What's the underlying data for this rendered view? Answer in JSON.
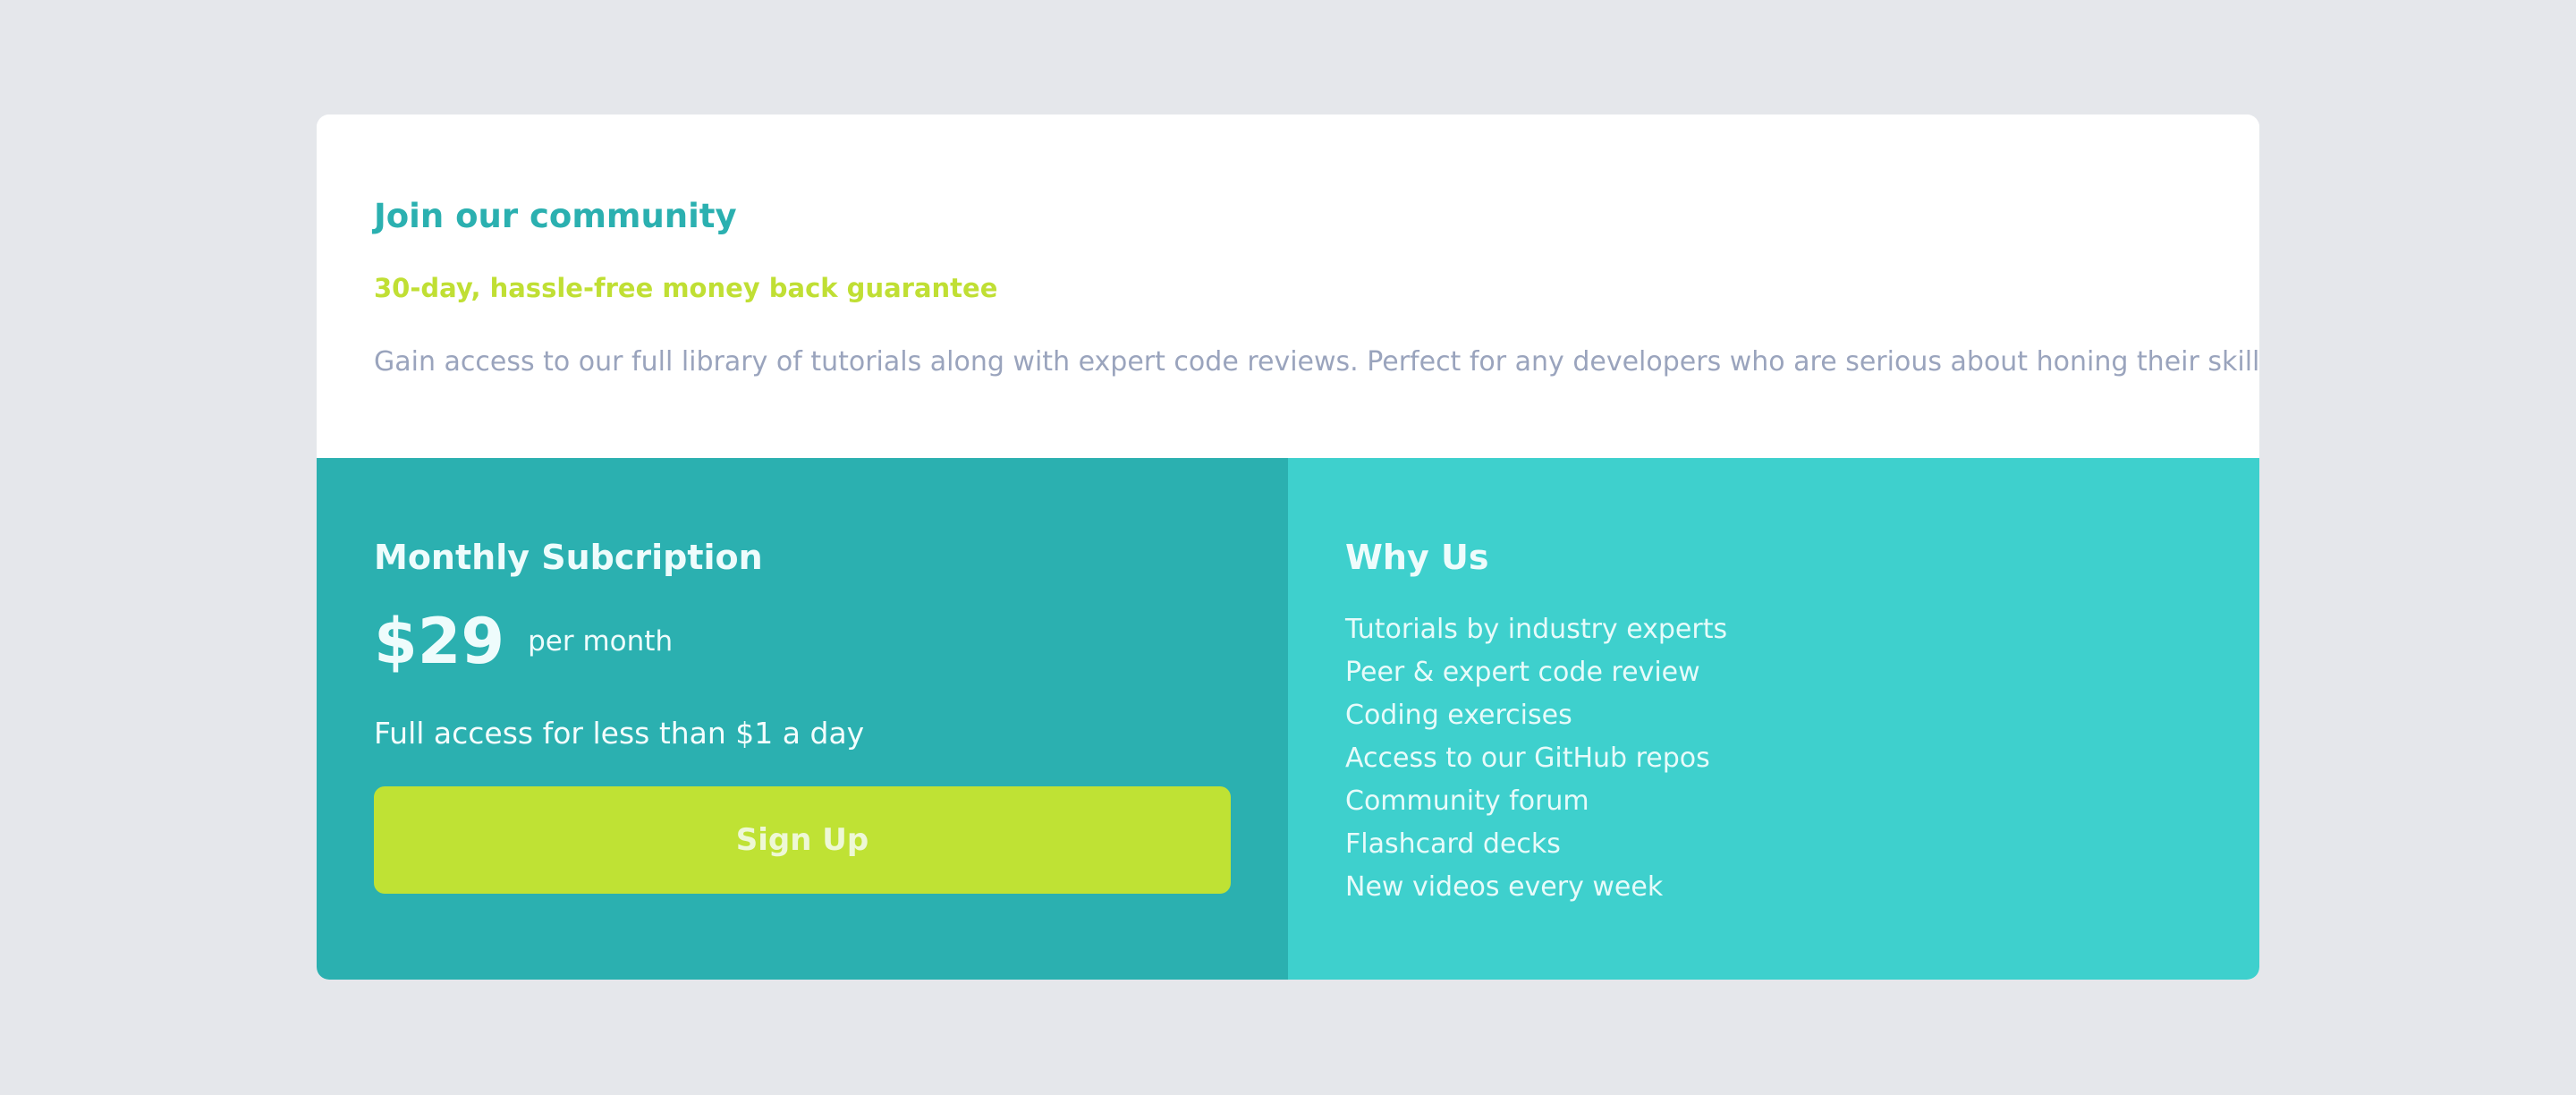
{
  "header": {
    "title": "Join our community",
    "guarantee": "30-day, hassle-free money back guarantee",
    "description": "Gain access to our full library of tutorials along with expert code reviews. Perfect for any developers who are serious about honing their skills."
  },
  "subscription": {
    "title": "Monthly Subcription",
    "price": "$29",
    "period": "per month",
    "tagline": "Full access for less than $1 a day",
    "button_label": "Sign Up"
  },
  "why_us": {
    "title": "Why Us",
    "items": [
      "Tutorials by industry experts",
      "Peer & expert code review",
      "Coding exercises",
      "Access to our GitHub repos",
      "Community forum",
      "Flashcard decks",
      "New videos every week"
    ]
  },
  "colors": {
    "page_background": "#e5e7eb",
    "primary_teal": "#2bb0b0",
    "light_teal": "#3ed0cd",
    "accent_lime": "#bfe234",
    "muted_text": "#9aa4bd"
  }
}
